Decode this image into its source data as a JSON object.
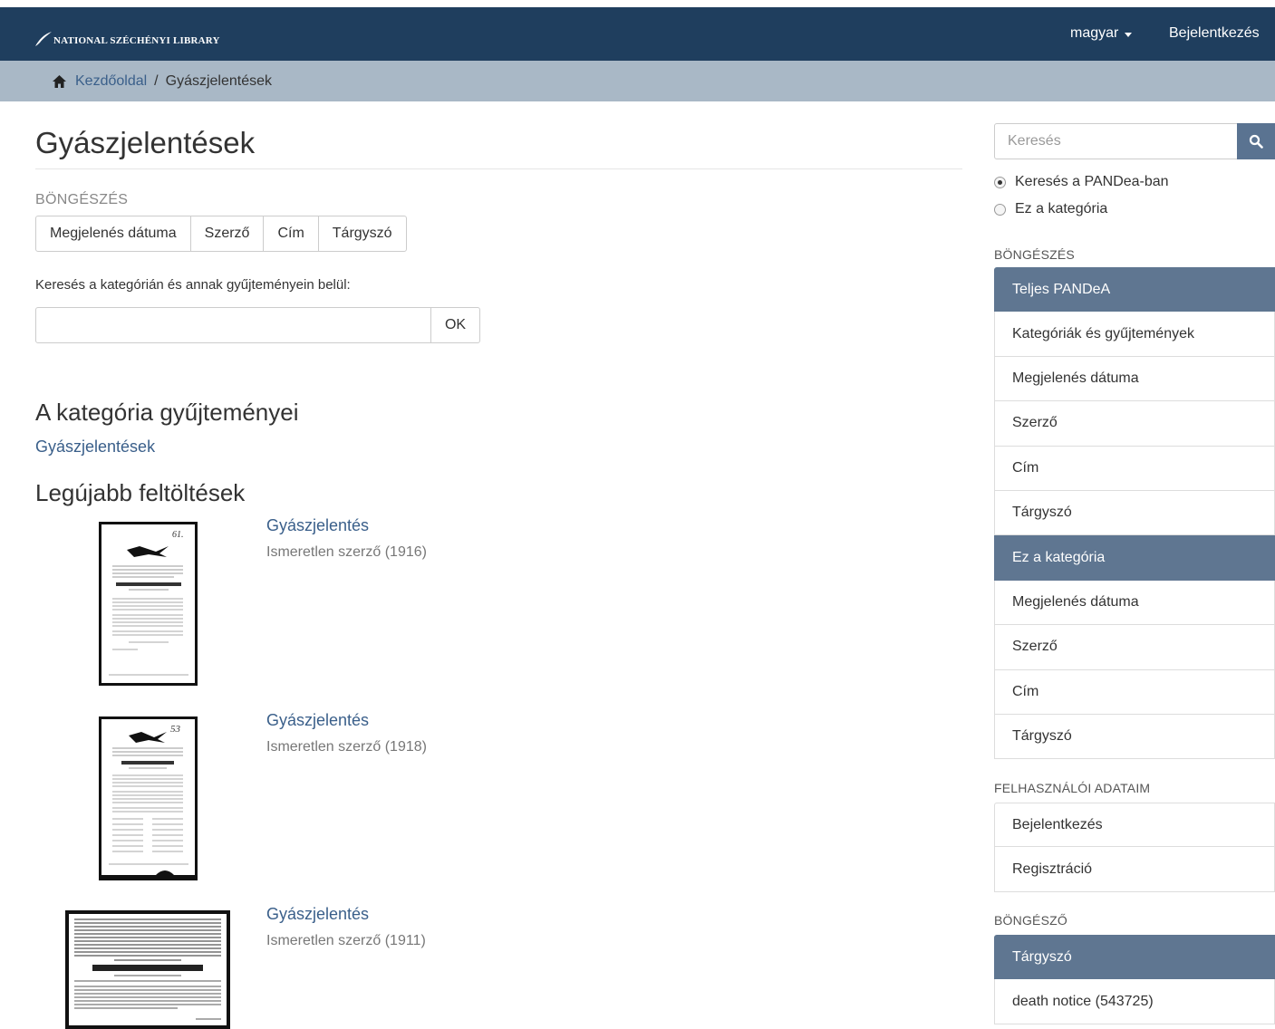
{
  "header": {
    "logo_text": "NATIONAL SZÉCHÉNYI LIBRARY",
    "language": "magyar",
    "login": "Bejelentkezés"
  },
  "breadcrumb": {
    "home": "Kezdőoldal",
    "separator": "/",
    "current": "Gyászjelentések"
  },
  "main": {
    "title": "Gyászjelentések",
    "browse_label": "BÖNGÉSZÉS",
    "browse_buttons": [
      "Megjelenés dátuma",
      "Szerző",
      "Cím",
      "Tárgyszó"
    ],
    "search_label": "Keresés a kategórián és annak gyűjteményein belül:",
    "search_value": "",
    "ok_label": "OK",
    "collections_heading": "A kategória gyűjteményei",
    "collection_link": "Gyászjelentések",
    "recent_heading": "Legújabb feltöltések",
    "recent_items": [
      {
        "title": "Gyászjelentés",
        "meta": "Ismeretlen szerző (1916)"
      },
      {
        "title": "Gyászjelentés",
        "meta": "Ismeretlen szerző (1918)"
      },
      {
        "title": "Gyászjelentés",
        "meta": "Ismeretlen szerző (1911)"
      }
    ]
  },
  "sidebar": {
    "search_placeholder": "Keresés",
    "radio_options": [
      {
        "label": "Keresés a PANDea-ban",
        "checked": true
      },
      {
        "label": "Ez a kategória",
        "checked": false
      }
    ],
    "browse_heading": "BÖNGÉSZÉS",
    "browse_list": [
      {
        "label": "Teljes PANDeA",
        "active": true
      },
      {
        "label": "Kategóriák és gyűjtemények"
      },
      {
        "label": "Megjelenés dátuma"
      },
      {
        "label": "Szerző"
      },
      {
        "label": "Cím"
      },
      {
        "label": "Tárgyszó"
      },
      {
        "label": "Ez a kategória",
        "active": true
      },
      {
        "label": "Megjelenés dátuma"
      },
      {
        "label": "Szerző"
      },
      {
        "label": "Cím"
      },
      {
        "label": "Tárgyszó"
      }
    ],
    "user_heading": "FELHASZNÁLÓI ADATAIM",
    "user_list": [
      {
        "label": "Bejelentkezés"
      },
      {
        "label": "Regisztráció"
      }
    ],
    "browser_heading": "BÖNGÉSZŐ",
    "browser_list": [
      {
        "label": "Tárgyszó",
        "active": true
      },
      {
        "label": "death notice (543725)"
      }
    ]
  },
  "colors": {
    "navbar": "#1f3e5e",
    "breadcrumb_bg": "#a9b8c6",
    "link": "#3a5f8a",
    "active_item": "#5f7691",
    "search_button": "#5a7391"
  }
}
